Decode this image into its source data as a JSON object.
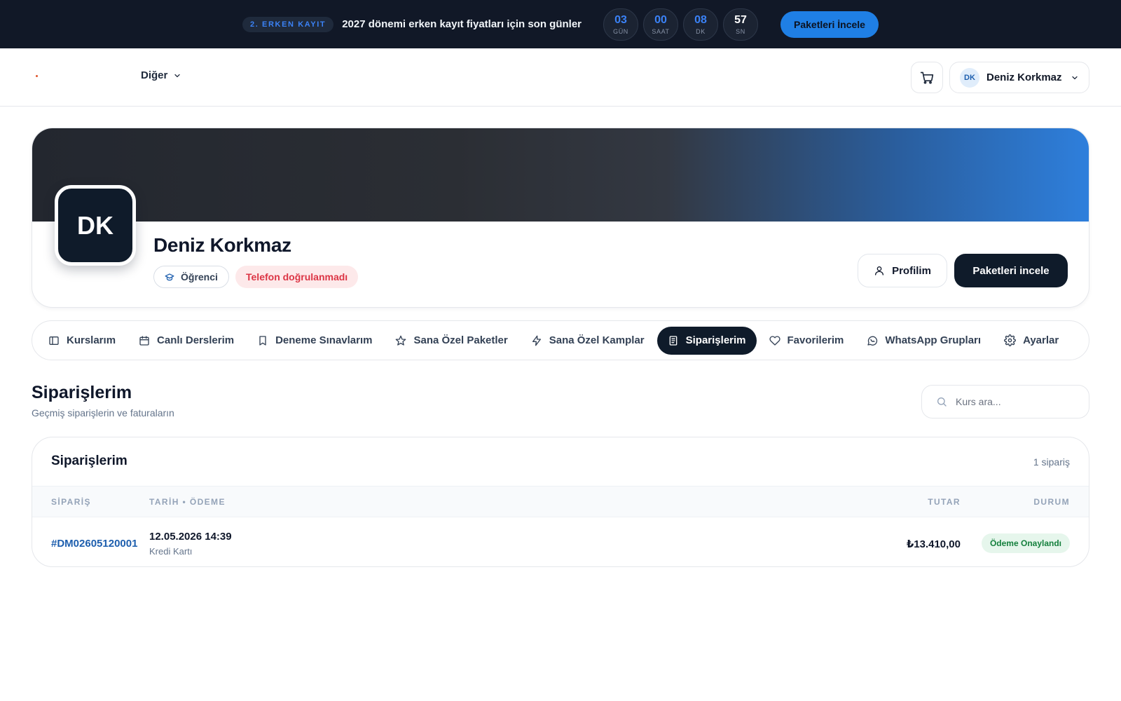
{
  "announcement": {
    "badge": "2. ERKEN KAYIT",
    "text": "2027 dönemi erken kayıt fiyatları için son günler",
    "countdown": [
      {
        "value": "03",
        "label": "GÜN"
      },
      {
        "value": "00",
        "label": "SAAT"
      },
      {
        "value": "08",
        "label": "DK"
      },
      {
        "value": "57",
        "label": "SN"
      }
    ],
    "cta": "Paketleri İncele"
  },
  "nav": {
    "more_label": "Diğer",
    "user": {
      "initials": "DK",
      "name": "Deniz Korkmaz"
    }
  },
  "profile": {
    "initials": "DK",
    "name": "Deniz Korkmaz",
    "role_badge": "Öğrenci",
    "warning_badge": "Telefon doğrulanmadı",
    "profile_button": "Profilim",
    "packages_button": "Paketleri incele"
  },
  "tabs": [
    {
      "label": "Kurslarım",
      "icon": "book-icon",
      "active": false
    },
    {
      "label": "Canlı Derslerim",
      "icon": "calendar-icon",
      "active": false
    },
    {
      "label": "Deneme Sınavlarım",
      "icon": "bookmark-icon",
      "active": false
    },
    {
      "label": "Sana Özel Paketler",
      "icon": "star-icon",
      "active": false
    },
    {
      "label": "Sana Özel Kamplar",
      "icon": "lightning-icon",
      "active": false
    },
    {
      "label": "Siparişlerim",
      "icon": "receipt-icon",
      "active": true
    },
    {
      "label": "Favorilerim",
      "icon": "heart-icon",
      "active": false
    },
    {
      "label": "WhatsApp Grupları",
      "icon": "whatsapp-icon",
      "active": false
    },
    {
      "label": "Ayarlar",
      "icon": "gear-icon",
      "active": false
    }
  ],
  "section": {
    "title": "Siparişlerim",
    "subtitle": "Geçmiş siparişlerin ve faturaların",
    "search_placeholder": "Kurs ara..."
  },
  "orders": {
    "title": "Siparişlerim",
    "count": "1 sipariş",
    "columns": {
      "order": "SİPARİŞ",
      "date_payment": "TARİH • ÖDEME",
      "amount": "TUTAR",
      "status": "DURUM"
    },
    "rows": [
      {
        "id": "#DM02605120001",
        "date": "12.05.2026 14:39",
        "payment": "Kredi Kartı",
        "amount": "₺13.410,00",
        "status": "Ödeme Onaylandı"
      }
    ],
    "status_color": "#15803d"
  },
  "colors": {
    "accent": "#1f7fe5",
    "dark": "#0f1b2a",
    "danger": "#dc3545"
  }
}
